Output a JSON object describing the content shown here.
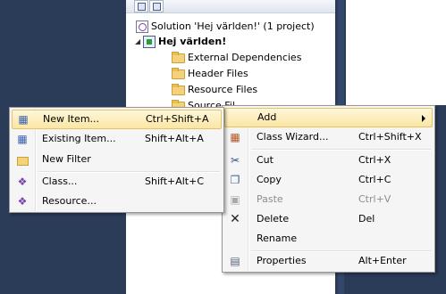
{
  "solution_explorer": {
    "solution_label": "Solution 'Hej världen!' (1 project)",
    "project_label": "Hej världen!",
    "folders": [
      "External Dependencies",
      "Header Files",
      "Resource Files",
      "Source Fil"
    ]
  },
  "main_menu": {
    "items": [
      {
        "label": "Add",
        "shortcut": "",
        "icon": "add-submenu"
      },
      {
        "label": "Class Wizard...",
        "shortcut": "Ctrl+Shift+X",
        "icon": "class-wizard-icon"
      },
      {
        "label": "Cut",
        "shortcut": "Ctrl+X",
        "icon": "scissors-icon"
      },
      {
        "label": "Copy",
        "shortcut": "Ctrl+C",
        "icon": "copy-icon"
      },
      {
        "label": "Paste",
        "shortcut": "Ctrl+V",
        "icon": "paste-icon",
        "disabled": true
      },
      {
        "label": "Delete",
        "shortcut": "Del",
        "icon": "delete-x-icon"
      },
      {
        "label": "Rename",
        "shortcut": "",
        "icon": ""
      },
      {
        "label": "Properties",
        "shortcut": "Alt+Enter",
        "icon": "properties-icon"
      }
    ]
  },
  "add_submenu": {
    "items": [
      {
        "label": "New Item...",
        "shortcut": "Ctrl+Shift+A",
        "icon": "new-item-icon"
      },
      {
        "label": "Existing Item...",
        "shortcut": "Shift+Alt+A",
        "icon": "existing-item-icon"
      },
      {
        "label": "New Filter",
        "shortcut": "",
        "icon": "new-filter-icon"
      },
      {
        "label": "Class...",
        "shortcut": "Shift+Alt+C",
        "icon": "class-icon"
      },
      {
        "label": "Resource...",
        "shortcut": "",
        "icon": "resource-icon"
      }
    ]
  },
  "colors": {
    "background": "#2b3c59",
    "highlight": "#fbe6a4",
    "menu_bg": "#f5f5f5"
  }
}
